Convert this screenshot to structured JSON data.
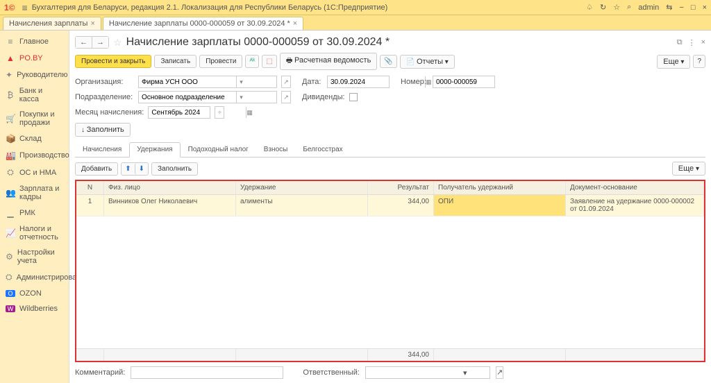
{
  "titlebar": {
    "app_title": "Бухгалтерия для Беларуси, редакция 2.1. Локализация для Республики Беларусь  (1С:Предприятие)",
    "user": "admin"
  },
  "tabs": [
    {
      "label": "Начисления зарплаты"
    },
    {
      "label": "Начисление зарплаты 0000-000059 от 30.09.2024 *"
    }
  ],
  "sidebar": [
    {
      "icon": "≡",
      "label": "Главное"
    },
    {
      "icon": "▲",
      "label": "PO.BY"
    },
    {
      "icon": "✦",
      "label": "Руководителю"
    },
    {
      "icon": "₿",
      "label": "Банк и касса"
    },
    {
      "icon": "🛒",
      "label": "Покупки и продажи"
    },
    {
      "icon": "📦",
      "label": "Склад"
    },
    {
      "icon": "🏭",
      "label": "Производство"
    },
    {
      "icon": "⛭",
      "label": "ОС и НМА"
    },
    {
      "icon": "👥",
      "label": "Зарплата и кадры"
    },
    {
      "icon": "▁",
      "label": "РМК"
    },
    {
      "icon": "📈",
      "label": "Налоги и отчетность"
    },
    {
      "icon": "⚙",
      "label": "Настройки учета"
    },
    {
      "icon": "⛭",
      "label": "Администрирование"
    },
    {
      "icon": "O",
      "label": "OZON"
    },
    {
      "icon": "W",
      "label": "Wildberries"
    }
  ],
  "doc": {
    "title": "Начисление зарплаты 0000-000059 от 30.09.2024 *"
  },
  "toolbar": {
    "provesti_zakryt": "Провести и закрыть",
    "zapisat": "Записать",
    "provesti": "Провести",
    "vedomost": "Расчетная ведомость",
    "otchety": "Отчеты",
    "more": "Еще",
    "help": "?"
  },
  "form": {
    "org_label": "Организация:",
    "org_value": "Фирма УСН ООО",
    "date_label": "Дата:",
    "date_value": "30.09.2024",
    "number_label": "Номер:",
    "number_value": "0000-000059",
    "podr_label": "Подразделение:",
    "podr_value": "Основное подразделение",
    "dividend_label": "Дивиденды:",
    "month_label": "Месяц начисления:",
    "month_value": "Сентябрь 2024",
    "fill_label": "Заполнить"
  },
  "subtabs": {
    "nach": "Начисления",
    "uderzh": "Удержания",
    "podoh": "Подоходный налог",
    "vznosy": "Взносы",
    "belgos": "Белгосстрах"
  },
  "subtoolbar": {
    "add": "Добавить",
    "fill": "Заполнить",
    "more": "Еще"
  },
  "table": {
    "headers": {
      "n": "N",
      "fio": "Физ. лицо",
      "ud": "Удержание",
      "res": "Результат",
      "pol": "Получатель удержаний",
      "doc": "Документ-основание"
    },
    "row": {
      "n": "1",
      "fio": "Винников Олег Николаевич",
      "ud": "алименты",
      "res": "344,00",
      "pol": "ОПИ",
      "doc": "Заявление на удержание 0000-000002 от 01.09.2024"
    },
    "total": "344,00"
  },
  "footer": {
    "comment_label": "Комментарий:",
    "resp_label": "Ответственный:"
  }
}
